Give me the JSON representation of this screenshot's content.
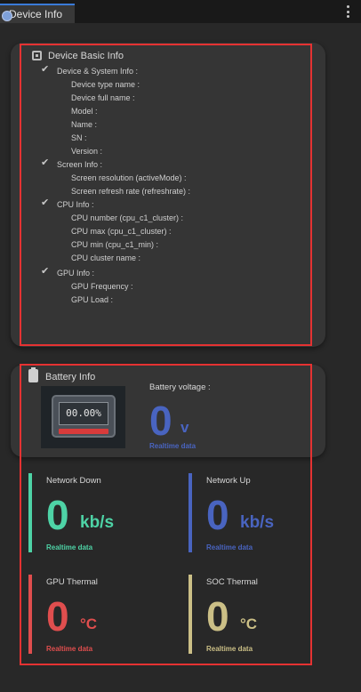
{
  "tab": {
    "title": "Device Info"
  },
  "device": {
    "title": "Device Basic Info",
    "check_glyph": "✔",
    "sections": [
      {
        "label": "Device & System Info :",
        "items": [
          "Device type name :",
          "Device full name :",
          "Model :",
          "Name :",
          "SN :",
          "Version :"
        ]
      },
      {
        "label": "Screen Info :",
        "items": [
          "Screen resolution (activeMode) :",
          "Screen refresh rate (refreshrate) :"
        ]
      },
      {
        "label": "CPU Info :",
        "items": [
          "CPU number (cpu_c1_cluster) :",
          "CPU max (cpu_c1_cluster) :",
          "CPU min (cpu_c1_min) :",
          "CPU cluster name :"
        ]
      },
      {
        "label": "GPU Info :",
        "items": [
          "GPU Frequency :",
          "GPU Load :"
        ]
      }
    ]
  },
  "battery": {
    "title": "Battery Info",
    "percent": "00.00%",
    "voltage_label": "Battery voltage :",
    "voltage_value": "0",
    "voltage_unit": "v",
    "realtime": "Realtime data"
  },
  "metrics": {
    "network_down": {
      "label": "Network Down",
      "value": "0",
      "unit": "kb/s",
      "sub": "Realtime data",
      "color": "#4ed3a6"
    },
    "network_up": {
      "label": "Network Up",
      "value": "0",
      "unit": "kb/s",
      "sub": "Realtime data",
      "color": "#4964c0"
    },
    "gpu_thermal": {
      "label": "GPU Thermal",
      "value": "0",
      "unit": "°C",
      "sub": "Realtime data",
      "color": "#e04e4e"
    },
    "soc_thermal": {
      "label": "SOC Thermal",
      "value": "0",
      "unit": "°C",
      "sub": "Realtime data",
      "color": "#cbbf86"
    }
  },
  "colors": {
    "accent": "#3a7ad8",
    "highlight_box": "#e53232",
    "voltage": "#4964c0"
  }
}
